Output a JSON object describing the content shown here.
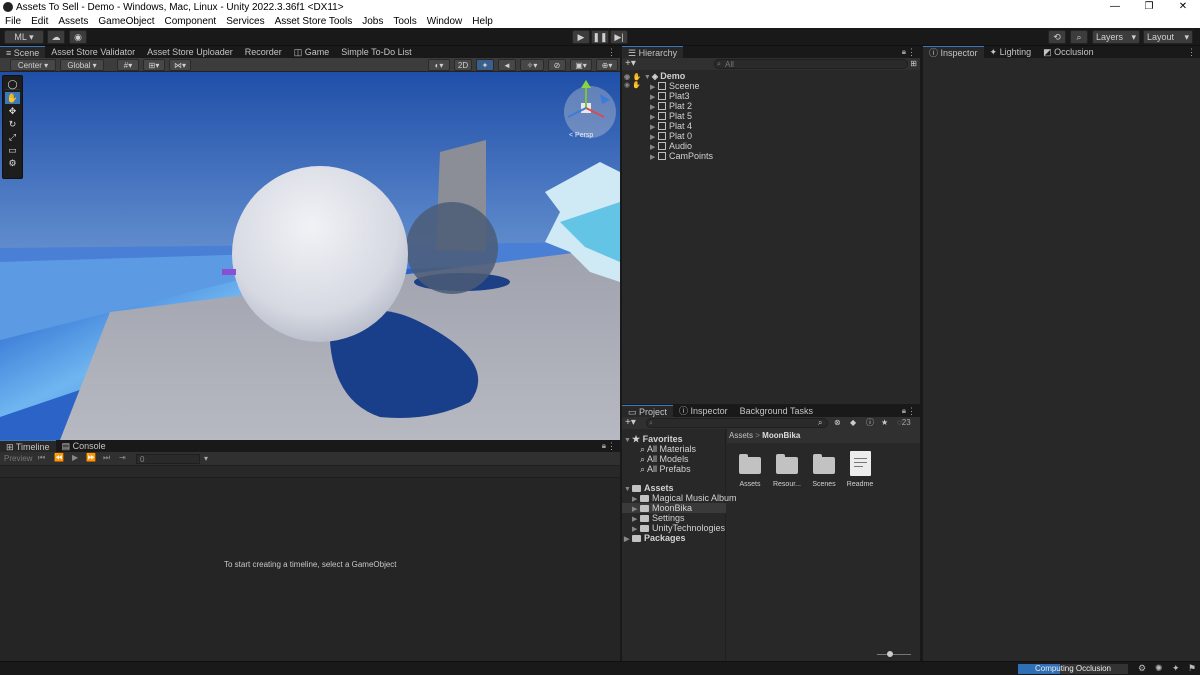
{
  "window": {
    "title": "Assets To Sell - Demo - Windows, Mac, Linux - Unity 2022.3.36f1 <DX11>",
    "minimize": "—",
    "restore": "❐",
    "close": "✕"
  },
  "menu": [
    "File",
    "Edit",
    "Assets",
    "GameObject",
    "Component",
    "Services",
    "Asset Store Tools",
    "Jobs",
    "Tools",
    "Window",
    "Help"
  ],
  "toolbar": {
    "account": "ML ▾",
    "play": "▶",
    "pause": "❚❚",
    "step": "▶|",
    "layers": "Layers",
    "layout": "Layout"
  },
  "scene_tabs": [
    "Scene",
    "Asset Store Validator",
    "Asset Store Uploader",
    "Recorder",
    "Game",
    "Simple To-Do List"
  ],
  "scene_toolbar": {
    "pivot": "Center",
    "space": "Global",
    "mode_2d": "2D"
  },
  "gizmo": {
    "persp": "< Persp"
  },
  "tools": [
    "✋",
    "✥",
    "↻",
    "⤢",
    "▭",
    "⚙"
  ],
  "hierarchy": {
    "tab": "Hierarchy",
    "search_placeholder": "All",
    "scene": "Demo",
    "items": [
      "Sceene",
      "Plat3",
      "Plat 2",
      "Plat 5",
      "Plat 4",
      "Plat 0",
      "Audio",
      "CamPoints"
    ]
  },
  "inspector_tabs": [
    "Inspector",
    "Lighting",
    "Occlusion"
  ],
  "timeline": {
    "tabs": [
      "Timeline",
      "Console"
    ],
    "preview": "Preview",
    "frame": "0",
    "message": "To start creating a timeline, select a GameObject"
  },
  "project": {
    "tabs": [
      "Project",
      "Inspector",
      "Background Tasks"
    ],
    "hidden_count": "23",
    "favorites_label": "Favorites",
    "favorites": [
      "All Materials",
      "All Models",
      "All Prefabs"
    ],
    "assets_label": "Assets",
    "asset_folders": [
      "Magical Music Album",
      "MoonBika",
      "Settings",
      "UnityTechnologies"
    ],
    "packages_label": "Packages",
    "breadcrumb": [
      "Assets",
      "MoonBika"
    ],
    "breadcrumb_sep": ">",
    "grid": [
      "Assets",
      "Resour...",
      "Scenes",
      "Readme"
    ]
  },
  "status": {
    "task": "Computing Occlusion"
  },
  "colors": {
    "accent": "#3a79bb",
    "panel": "#282828",
    "sky": "#2d5aa8"
  }
}
